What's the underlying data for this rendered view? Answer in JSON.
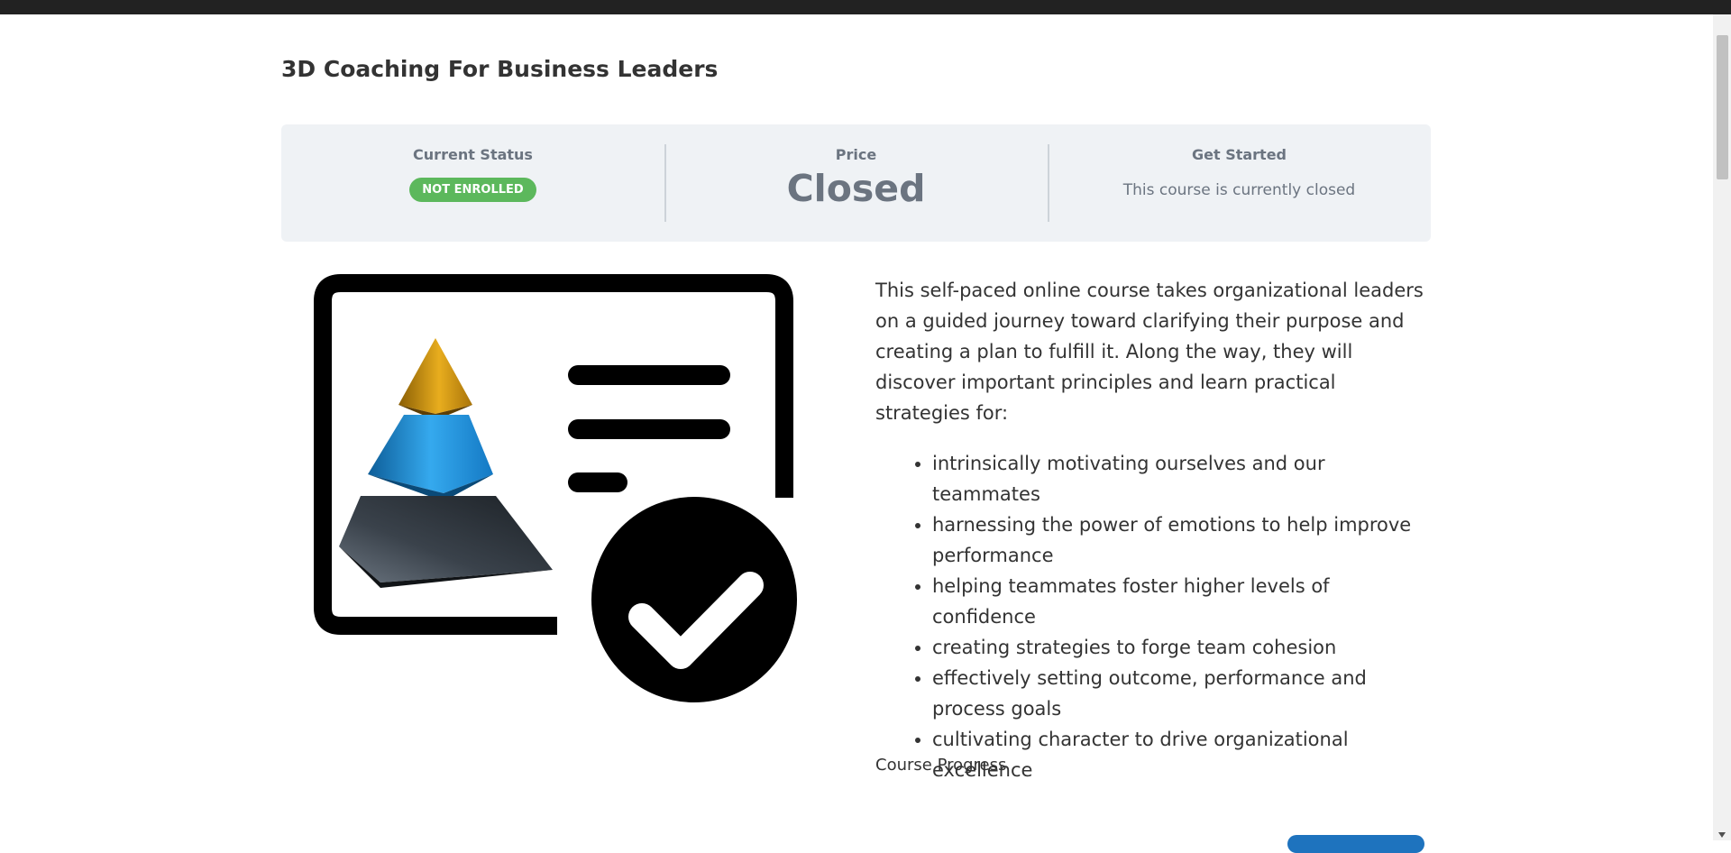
{
  "page": {
    "title": "3D Coaching For Business Leaders"
  },
  "status": {
    "current_status_heading": "Current Status",
    "badge_label": "NOT ENROLLED",
    "price_heading": "Price",
    "price_value": "Closed",
    "get_started_heading": "Get Started",
    "get_started_text": "This course is currently closed"
  },
  "description": {
    "intro": "This self-paced online course takes organizational leaders on a guided journey toward clarifying their purpose and creating a plan to fulfill it. Along the way, they will discover important principles and learn practical strategies for:",
    "bullets": [
      "intrinsically motivating ourselves and our teammates",
      "harnessing the power of emotions to help improve performance",
      "helping teammates foster higher levels of confidence",
      "creating strategies to forge team cohesion",
      "effectively setting outcome, performance and process goals",
      "cultivating character to drive organizational excellence"
    ]
  },
  "progress": {
    "label": "Course Progress"
  },
  "colors": {
    "badge": "#5cb85c",
    "status_bar_bg": "#eff2f5",
    "status_text": "#6b7480",
    "pyramid_gold": "#d9a01c",
    "pyramid_blue": "#1e8fd6",
    "pyramid_dark": "#2c3238"
  },
  "icons": {
    "course_image": "certificate-pyramid-checkmark-icon"
  }
}
